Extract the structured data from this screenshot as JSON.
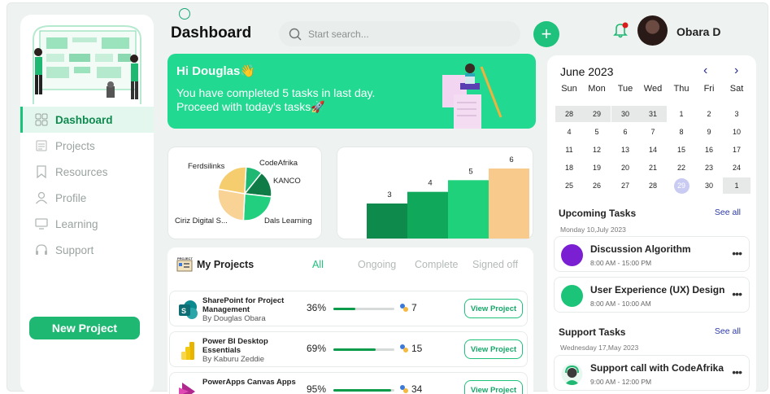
{
  "header": {
    "title": "Dashboard",
    "search_placeholder": "Start search...",
    "user_name": "Obara D"
  },
  "sidebar": {
    "items": [
      {
        "label": "Dashboard",
        "icon": "grid-icon",
        "active": true
      },
      {
        "label": "Projects",
        "icon": "clipboard-icon"
      },
      {
        "label": "Resources",
        "icon": "bookmark-icon"
      },
      {
        "label": "Profile",
        "icon": "user-icon"
      },
      {
        "label": "Learning",
        "icon": "monitor-icon"
      },
      {
        "label": "Support",
        "icon": "headset-icon"
      }
    ],
    "new_project_label": "New Project"
  },
  "hero": {
    "greeting": "Hi Douglas👋",
    "message": "You have completed 5 tasks in last day. Proceed with today's tasks🚀"
  },
  "chart_data": [
    {
      "type": "pie",
      "categories": [
        "CodeAfrika",
        "KANCO",
        "Dals Learning",
        "Ciriz Digital S...",
        "Ferdsilinks"
      ],
      "colors": [
        "#1fb873",
        "#0f7b47",
        "#22cf7e",
        "#f8d395",
        "#f5cd6e"
      ],
      "values": [
        10,
        16,
        24,
        27,
        23
      ],
      "title": "",
      "xlabel": "",
      "ylabel": ""
    },
    {
      "type": "bar",
      "categories": [
        "",
        "",
        "",
        ""
      ],
      "values": [
        3,
        4,
        5,
        6
      ],
      "colors": [
        "#0f8a4d",
        "#10a85b",
        "#1ed17a",
        "#f8cb8c"
      ],
      "title": "",
      "xlabel": "",
      "ylabel": "",
      "ylim": [
        0,
        6
      ]
    }
  ],
  "projects": {
    "title": "My Projects",
    "tabs": [
      "All",
      "Ongoing",
      "Complete",
      "Signed off"
    ],
    "active_tab": "All",
    "view_label": "View Project",
    "rows": [
      {
        "name": "SharePoint for Project Management",
        "by": "By Douglas Obara",
        "percent": "36%",
        "progress": 0.36,
        "count": "7",
        "icon": "sharepoint-icon"
      },
      {
        "name": "Power BI Desktop Essentials",
        "by": "By Kaburu Zeddie",
        "percent": "69%",
        "progress": 0.69,
        "count": "15",
        "icon": "powerbi-icon"
      },
      {
        "name": "PowerApps Canvas Apps",
        "by": "",
        "percent": "95%",
        "progress": 0.95,
        "count": "34",
        "icon": "powerapps-icon"
      }
    ]
  },
  "calendar": {
    "month": "June 2023",
    "weekdays": [
      "Sun",
      "Mon",
      "Tue",
      "Wed",
      "Thu",
      "Fri",
      "Sat"
    ],
    "weeks": [
      [
        "28",
        "29",
        "30",
        "31",
        "1",
        "2",
        "3"
      ],
      [
        "4",
        "5",
        "6",
        "7",
        "8",
        "9",
        "10"
      ],
      [
        "11",
        "12",
        "13",
        "14",
        "15",
        "16",
        "17"
      ],
      [
        "18",
        "19",
        "20",
        "21",
        "22",
        "23",
        "24"
      ],
      [
        "25",
        "26",
        "27",
        "28",
        "29",
        "30",
        "1"
      ]
    ],
    "today": "29"
  },
  "upcoming": {
    "title": "Upcoming Tasks",
    "see_all": "See all",
    "date": "Monday 10,July 2023",
    "items": [
      {
        "name": "Discussion Algorithm",
        "time": "8:00 AM - 15:00 PM",
        "color": "#7a1fd1"
      },
      {
        "name": "User Experience (UX) Design",
        "time": "8:00 AM - 10:00 AM",
        "color": "#1cc47a"
      }
    ]
  },
  "support": {
    "title": "Support Tasks",
    "see_all": "See all",
    "date": "Wednesday 17,May 2023",
    "items": [
      {
        "name": "Support call with CodeAfrika",
        "time": "9:00 AM - 12:00 PM"
      }
    ]
  }
}
